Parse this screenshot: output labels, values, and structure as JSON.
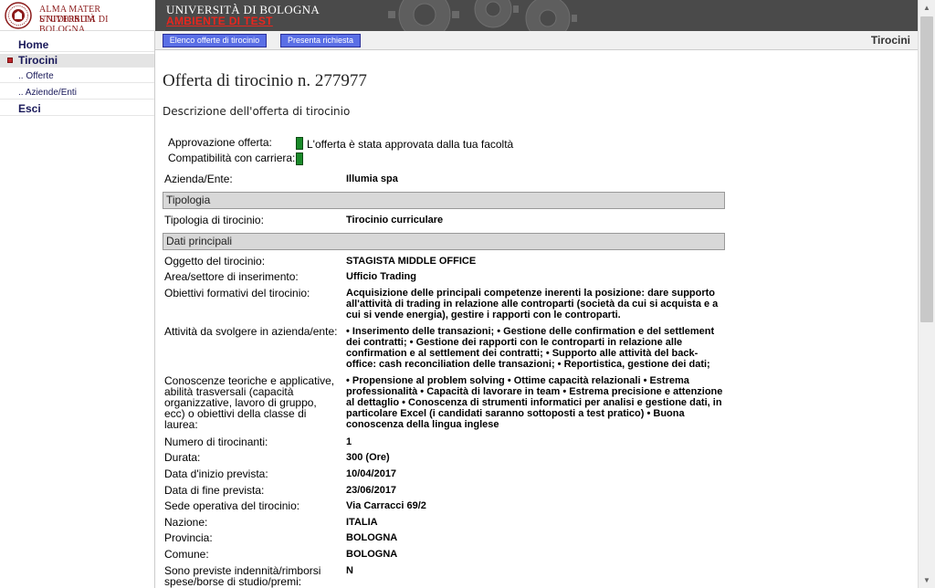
{
  "logo": {
    "line1": "ALMA MATER STUDIORUM",
    "line2": "UNIVERSITÀ DI BOLOGNA"
  },
  "banner": {
    "university": "UNIVERSITÀ DI BOLOGNA",
    "environment": "AMBIENTE DI TEST"
  },
  "topnav": {
    "elenco_label": "Elenco offerte di tirocinio",
    "presenta_label": "Presenta richiesta",
    "section_title": "Tirocini"
  },
  "sidebar": {
    "items": [
      {
        "label": "Home"
      },
      {
        "label": "Tirocini"
      },
      {
        "label": ".. Offerte"
      },
      {
        "label": ".. Aziende/Enti"
      },
      {
        "label": "Esci"
      }
    ]
  },
  "main": {
    "title": "Offerta di tirocinio n. 277977",
    "subtitle": "Descrizione dell'offerta di tirocinio",
    "approval": {
      "label": "Approvazione offerta:",
      "status_text": "L'offerta è stata approvata dalla tua facoltà",
      "compat_label": "Compatibilità con carriera:",
      "indicator_color": "#1a8a2a"
    },
    "azienda_label": "Azienda/Ente:",
    "azienda_value": "Illumia spa",
    "section_tipologia": "Tipologia",
    "tipologia_label": "Tipologia di tirocinio:",
    "tipologia_value": "Tirocinio curriculare",
    "section_dati": "Dati principali",
    "rows": [
      {
        "label": "Oggetto del tirocinio:",
        "value": "STAGISTA MIDDLE OFFICE"
      },
      {
        "label": "Area/settore di inserimento:",
        "value": "Ufficio Trading"
      },
      {
        "label": "Obiettivi formativi del tirocinio:",
        "value": "Acquisizione delle principali competenze inerenti la posizione: dare supporto all'attività di trading in relazione alle controparti (società da cui si acquista e a cui si vende energia), gestire i rapporti con le controparti."
      },
      {
        "label": "Attività da svolgere in azienda/ente:",
        "value": "• Inserimento delle transazioni; • Gestione delle confirmation e del settlement dei contratti; • Gestione dei rapporti con le controparti in relazione alle confirmation e al settlement dei contratti; • Supporto alle attività del back-office: cash reconciliation delle transazioni; • Reportistica, gestione dei dati;"
      },
      {
        "label": "Conoscenze teoriche e applicative, abilità trasversali (capacità organizzative, lavoro di gruppo, ecc) o obiettivi della classe di laurea:",
        "value": "• Propensione al problem solving • Ottime capacità relazionali • Estrema professionalità • Capacità di lavorare in team • Estrema precisione e attenzione al dettaglio • Conoscenza di strumenti informatici per analisi e gestione dati, in particolare Excel (i candidati saranno sottoposti a test pratico) • Buona conoscenza della lingua inglese"
      },
      {
        "label": "Numero di tirocinanti:",
        "value": "1"
      },
      {
        "label": "Durata:",
        "value": "300 (Ore)"
      },
      {
        "label": "Data d'inizio prevista:",
        "value": "10/04/2017"
      },
      {
        "label": "Data di fine prevista:",
        "value": "23/06/2017"
      },
      {
        "label": "Sede operativa del tirocinio:",
        "value": "Via Carracci 69/2"
      },
      {
        "label": "Nazione:",
        "value": "ITALIA"
      },
      {
        "label": "Provincia:",
        "value": "BOLOGNA"
      },
      {
        "label": "Comune:",
        "value": "BOLOGNA"
      },
      {
        "label": "Sono previste indennità/rimborsi spese/borse di studio/premi:",
        "value": "N"
      }
    ]
  },
  "colors": {
    "accent_button": "#5a6fe6",
    "banner_bg": "#4a4a4a",
    "test_env_red": "#e8261e",
    "approved_green": "#1a8a2a"
  }
}
